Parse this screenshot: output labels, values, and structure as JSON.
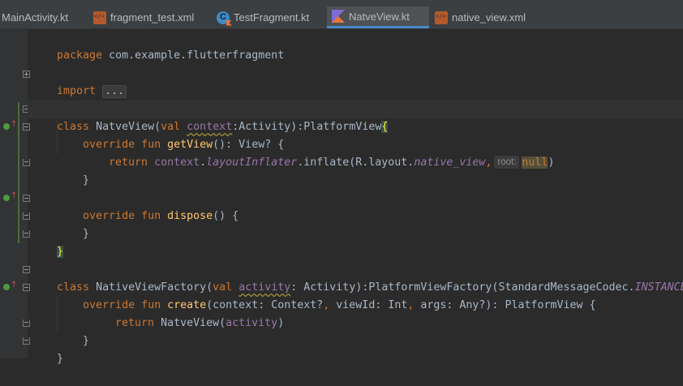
{
  "tabs": [
    {
      "label": "MainActivity.kt",
      "icon": "kotlin-file-icon",
      "active": false
    },
    {
      "label": "fragment_test.xml",
      "icon": "xml-file-icon",
      "active": false
    },
    {
      "label": "TestFragment.kt",
      "icon": "kotlin-class-icon",
      "active": false
    },
    {
      "label": "NatveView.kt",
      "icon": "kotlin-file-icon",
      "active": true
    },
    {
      "label": "native_view.xml",
      "icon": "xml-file-icon",
      "active": false
    }
  ],
  "code": {
    "line1": {
      "kw": "package",
      "rest": " com.example.flutterfragment"
    },
    "line3": {
      "kw": "import",
      "fold": "..."
    },
    "line5": {
      "kw1": "class",
      "name": " NatveView(",
      "kw2": "val",
      "param": "context",
      "rest": ":Activity):PlatformView",
      "brace": "{"
    },
    "line6": {
      "kw": "override fun ",
      "fn": "getView",
      "rest": "(): View? {"
    },
    "line7": {
      "kw": "return ",
      "prop": "context",
      "dot1": ".",
      "propi": "layoutInflater",
      "mid": ".inflate(R.layout.",
      "propi2": "native_view",
      "comma": ",",
      "hint": "root:",
      "nul": "null",
      "close": ")"
    },
    "line8": {
      "text": "}"
    },
    "line10": {
      "kw": "override fun ",
      "fn": "dispose",
      "rest": "() {"
    },
    "line11": {
      "text": "}"
    },
    "line12": {
      "text": "}"
    },
    "line14": {
      "kw1": "class",
      "name": " NativeViewFactory(",
      "kw2": "val",
      "param": "activity",
      "rest": ": Activity):PlatformViewFactory(StandardMessageCodec.",
      "propi": "INSTANCE",
      "end": "){"
    },
    "line15": {
      "kw": "override fun ",
      "fn": "create",
      "rest": "(context: Context?",
      "c1": ",",
      "r2": " viewId: Int",
      "c2": ",",
      "r3": " args: Any?): PlatformView {"
    },
    "line16": {
      "kw": "return ",
      "rest": "NatveView(",
      "prop": "activity",
      "end": ")"
    },
    "line17": {
      "text": "}"
    },
    "line18": {
      "text": "}"
    }
  },
  "colors": {
    "background": "#2b2b2b",
    "keyword": "#cc7832",
    "function": "#ffc66d",
    "property": "#9876aa",
    "text": "#a9b7c6",
    "active_tab_underline": "#4a88c7"
  }
}
